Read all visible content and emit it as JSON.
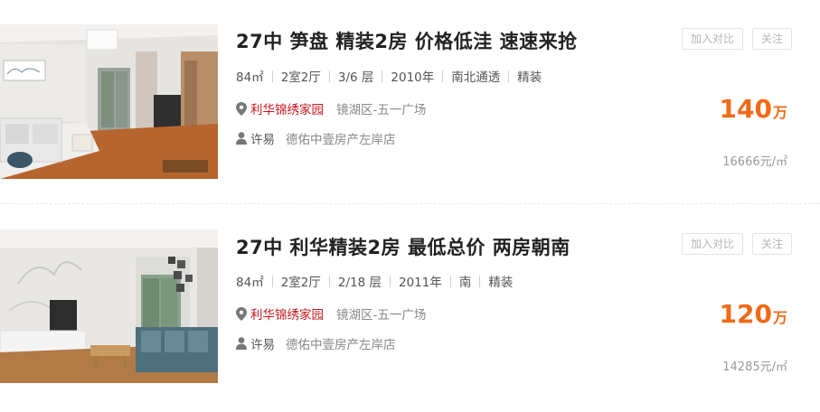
{
  "listings": [
    {
      "title": "27中 笋盘 精装2房 价格低洼 速速来抢",
      "area": "84㎡",
      "layout": "2室2厅",
      "floor": "3/6 层",
      "year": "2010年",
      "orientation": "南北通透",
      "decoration": "精装",
      "community": "利华锦绣家园",
      "district": "镜湖区-五一广场",
      "agent": "许易",
      "agency": "德佑中壹房产左岸店",
      "compare_label": "加入对比",
      "follow_label": "关注",
      "price": "140",
      "price_unit": "万",
      "unit_price": "16666元/㎡",
      "photo_icon": "living-room-photo"
    },
    {
      "title": "27中 利华精装2房 最低总价 两房朝南",
      "area": "84㎡",
      "layout": "2室2厅",
      "floor": "2/18 层",
      "year": "2011年",
      "orientation": "南",
      "decoration": "精装",
      "community": "利华锦绣家园",
      "district": "镜湖区-五一广场",
      "agent": "许易",
      "agency": "德佑中壹房产左岸店",
      "compare_label": "加入对比",
      "follow_label": "关注",
      "price": "120",
      "price_unit": "万",
      "unit_price": "14285元/㎡",
      "photo_icon": "living-room-photo"
    }
  ],
  "colors": {
    "price": "#f06a16",
    "community": "#c8161d",
    "muted": "#999999"
  }
}
